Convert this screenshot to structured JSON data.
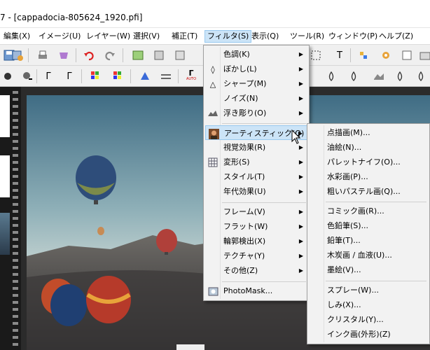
{
  "window": {
    "title": "7 - [cappadocia-805624_1920.pfi]"
  },
  "menubar": {
    "items": [
      {
        "label": "編集(X)"
      },
      {
        "label": "イメージ(U)"
      },
      {
        "label": "レイヤー(W)"
      },
      {
        "label": "選択(V)"
      },
      {
        "label": "補正(T)"
      },
      {
        "label": "フィルタ(S)"
      },
      {
        "label": "表示(Q)"
      },
      {
        "label": "ツール(R)"
      },
      {
        "label": "ウィンドウ(P)"
      },
      {
        "label": "ヘルプ(Z)"
      }
    ],
    "active": "フィルタ(S)"
  },
  "toolbar2": {
    "zoom_label": "AUTO"
  },
  "filter_menu": {
    "items": [
      {
        "label": "色調(K)",
        "icon": "none",
        "submenu": true
      },
      {
        "label": "ぼかし(L)",
        "icon": "drop-icon",
        "submenu": true
      },
      {
        "label": "シャープ(M)",
        "icon": "triangle-icon",
        "submenu": true
      },
      {
        "label": "ノイズ(N)",
        "icon": "none",
        "submenu": true
      },
      {
        "label": "浮き彫り(O)",
        "icon": "emboss-icon",
        "submenu": true
      },
      {
        "label": "アーティスティック(Q)",
        "icon": "portrait-icon",
        "submenu": true,
        "highlighted": true
      },
      {
        "label": "視覚効果(R)",
        "icon": "none",
        "submenu": true
      },
      {
        "label": "変形(S)",
        "icon": "grid-icon",
        "submenu": true
      },
      {
        "label": "スタイル(T)",
        "icon": "none",
        "submenu": true
      },
      {
        "label": "年代効果(U)",
        "icon": "none",
        "submenu": true
      },
      {
        "label": "フレーム(V)",
        "icon": "none",
        "submenu": true
      },
      {
        "label": "フラット(W)",
        "icon": "none",
        "submenu": true
      },
      {
        "label": "輪郭検出(X)",
        "icon": "none",
        "submenu": true
      },
      {
        "label": "テクチャ(Y)",
        "icon": "none",
        "submenu": true
      },
      {
        "label": "その他(Z)",
        "icon": "none",
        "submenu": true
      },
      {
        "label": "PhotoMask...",
        "icon": "photomask-icon",
        "submenu": false
      }
    ]
  },
  "artistic_submenu": {
    "items": [
      {
        "label": "点描画(M)..."
      },
      {
        "label": "油絵(N)..."
      },
      {
        "label": "パレットナイフ(O)..."
      },
      {
        "label": "水彩画(P)..."
      },
      {
        "label": "粗いパステル画(Q)..."
      },
      {
        "label": "コミック画(R)..."
      },
      {
        "label": "色鉛筆(S)..."
      },
      {
        "label": "鉛筆(T)..."
      },
      {
        "label": "木炭画 / 血液(U)..."
      },
      {
        "label": "墨絵(V)..."
      },
      {
        "label": "スプレー(W)..."
      },
      {
        "label": "しみ(X)..."
      },
      {
        "label": "クリスタル(Y)..."
      },
      {
        "label": "インク画(外形)(Z)"
      }
    ]
  },
  "colors": {
    "highlight": "#cce4f7",
    "highlight_border": "#99c9ef",
    "menu_bg": "#f2f2f2"
  }
}
